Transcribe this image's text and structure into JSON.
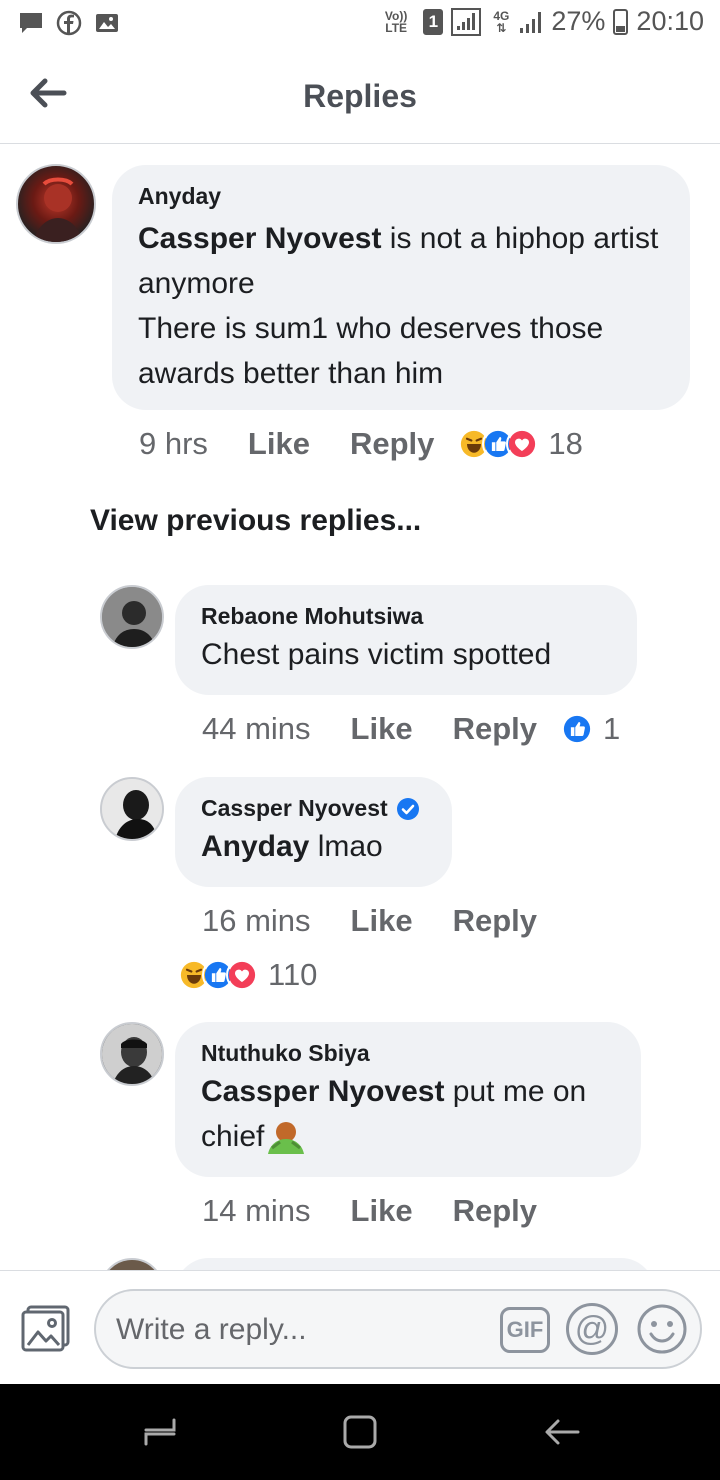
{
  "status_bar": {
    "battery": "27%",
    "time": "20:10",
    "volte": "Vo)) LTE",
    "sim": "1",
    "network": "4G",
    "icons": [
      "chat-icon",
      "facebook-icon",
      "gallery-icon"
    ]
  },
  "header": {
    "title": "Replies",
    "back_icon": "arrow-left-icon"
  },
  "main_comment": {
    "author": "Anyday",
    "mention": "Cassper Nyovest",
    "text_rest": " is not a hiphop artist anymore",
    "line2": "There is sum1 who deserves those awards better than him",
    "time": "9 hrs",
    "like": "Like",
    "reply": "Reply",
    "reactions": [
      "haha",
      "like",
      "love"
    ],
    "reaction_count": "18"
  },
  "view_previous": "View previous replies...",
  "replies": [
    {
      "author": "Rebaone Mohutsiwa",
      "text": "Chest pains victim spotted",
      "time": "44 mins",
      "like": "Like",
      "reply": "Reply",
      "reactions": [
        "like"
      ],
      "reaction_count": "1"
    },
    {
      "author": "Cassper Nyovest",
      "verified": true,
      "mention": "Anyday",
      "text_rest": " lmao",
      "time": "16 mins",
      "like": "Like",
      "reply": "Reply",
      "reactions": [
        "haha",
        "like",
        "love"
      ],
      "reaction_count": "110"
    },
    {
      "author": "Ntuthuko Sbiya",
      "mention": "Cassper Nyovest",
      "text_rest": " put me on",
      "line2": "chief",
      "emoji": "person-bowing-emoji",
      "time": "14 mins",
      "like": "Like",
      "reply": "Reply"
    }
  ],
  "composer": {
    "placeholder": "Write a reply...",
    "gif_label": "GIF",
    "at_label": "@"
  },
  "colors": {
    "like_blue": "#1877f2",
    "love_red": "#f33e58",
    "haha_yellow": "#f7b928",
    "bubble_bg": "#f0f2f5",
    "meta_gray": "#65676b"
  }
}
